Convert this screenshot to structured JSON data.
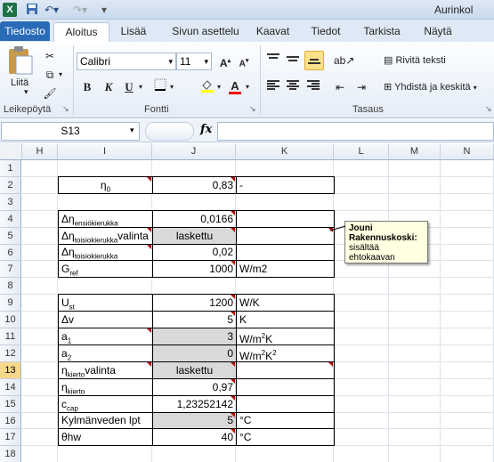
{
  "titlebar": {
    "app_icon": "excel-icon",
    "title": "Aurinkol"
  },
  "tabs": [
    "Tiedosto",
    "Aloitus",
    "Lisää",
    "Sivun asettelu",
    "Kaavat",
    "Tiedot",
    "Tarkista",
    "Näytä"
  ],
  "ribbon": {
    "paste_label": "Liitä",
    "clipboard_label": "Leikepöytä",
    "font_name": "Calibri",
    "font_size": "11",
    "font_label": "Fontti",
    "bold": "B",
    "italic": "K",
    "underline": "U",
    "wrap_text": "Rivitä teksti",
    "merge_center": "Yhdistä ja keskitä",
    "alignment_label": "Tasaus"
  },
  "formula_bar": {
    "name_box": "S13",
    "fx": "fx",
    "formula": ""
  },
  "columns": [
    "H",
    "I",
    "J",
    "K",
    "L",
    "M",
    "N"
  ],
  "rows": [
    "1",
    "2",
    "3",
    "4",
    "5",
    "6",
    "7",
    "8",
    "9",
    "10",
    "11",
    "12",
    "13",
    "14",
    "15",
    "16",
    "17",
    "18"
  ],
  "selected_row": "13",
  "cells": {
    "r2": {
      "label": "η0",
      "value": "0,83",
      "unit": "-"
    },
    "r4": {
      "label": "Δηensiökierukka",
      "value": "0,0166",
      "unit": ""
    },
    "r5": {
      "label": "Δηtoisiokierukkavalinta",
      "value": "laskettu",
      "unit": ""
    },
    "r6": {
      "label": "Δηtoisiokierukka",
      "value": "0,02",
      "unit": ""
    },
    "r7": {
      "label": "Gref",
      "value": "1000",
      "unit": "W/m2"
    },
    "r9": {
      "label": "Ust",
      "value": "1200",
      "unit": "W/K"
    },
    "r10": {
      "label": "Δv",
      "value": "5",
      "unit": "K"
    },
    "r11": {
      "label": "a1",
      "value": "3",
      "unit": "W/m2K"
    },
    "r12": {
      "label": "a2",
      "value": "0",
      "unit": "W/m2K2"
    },
    "r13": {
      "label": "ηkiertovalinta",
      "value": "laskettu",
      "unit": ""
    },
    "r14": {
      "label": "ηkierto",
      "value": "0,97",
      "unit": ""
    },
    "r15": {
      "label": "ccap",
      "value": "1,23252142",
      "unit": ""
    },
    "r16": {
      "label": "Kylmänveden lpt",
      "value": "5",
      "unit": "°C"
    },
    "r17": {
      "label": "θhw",
      "value": "40",
      "unit": "°C"
    }
  },
  "comment": {
    "author": "Jouni Rakennuskoski:",
    "text": "sisältää ehtokaavan"
  }
}
